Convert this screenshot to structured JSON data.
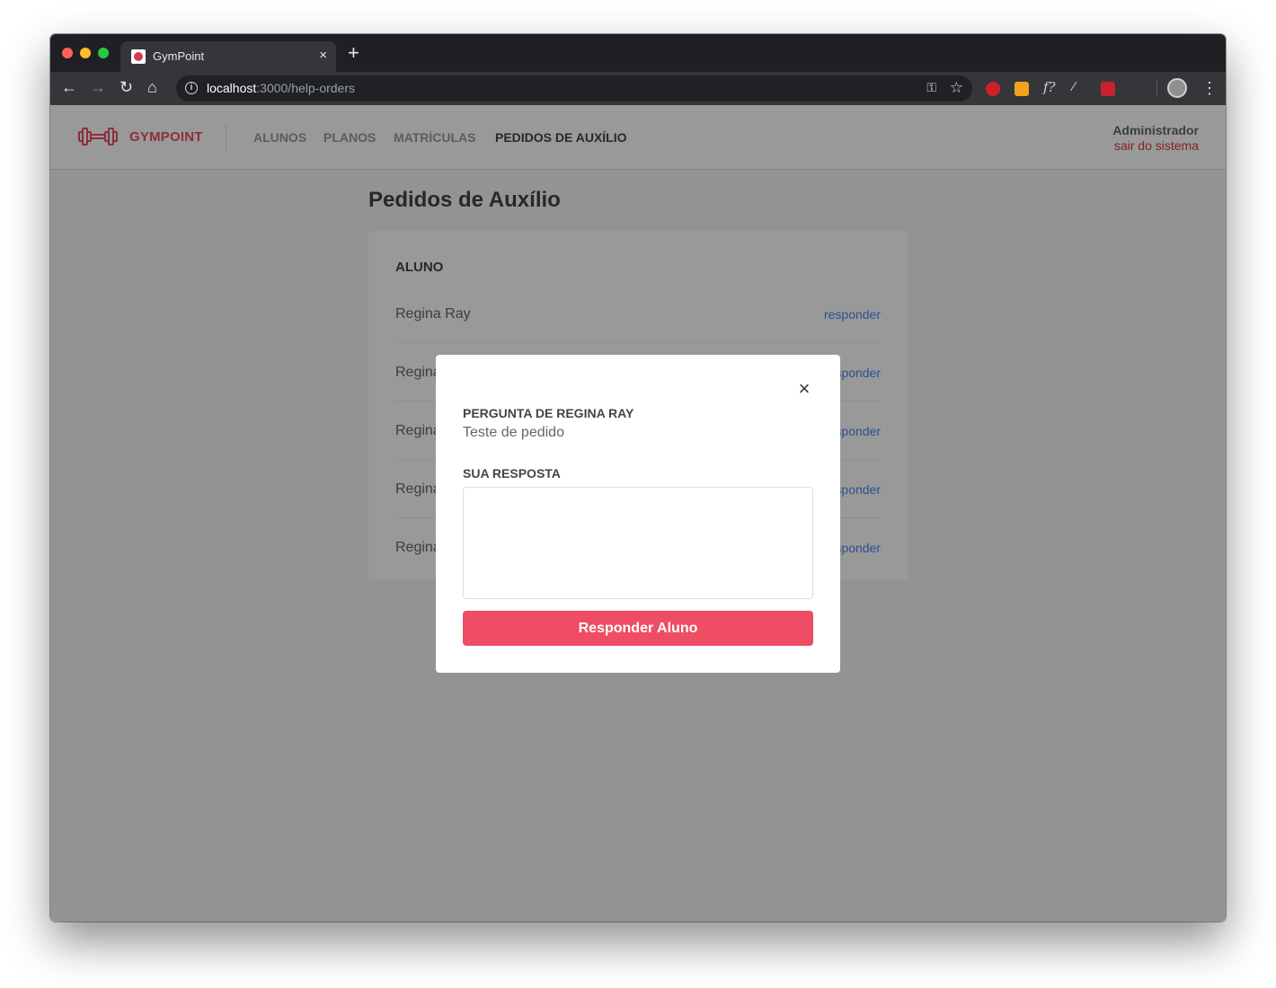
{
  "browser": {
    "tab_title": "GymPoint",
    "tab_close": "×",
    "new_tab": "+",
    "url_host": "localhost",
    "url_path": ":3000/help-orders"
  },
  "header": {
    "logo_text": "GYMPOINT",
    "nav": {
      "alunos": "ALUNOS",
      "planos": "PLANOS",
      "matriculas": "MATRÍCULAS",
      "pedidos": "PEDIDOS DE AUXÍLIO"
    },
    "user_name": "Administrador",
    "logout": "sair do sistema"
  },
  "main": {
    "title": "Pedidos de Auxílio",
    "column_header": "ALUNO",
    "rows": [
      {
        "name": "Regina Ray",
        "action": "responder"
      },
      {
        "name": "Regina Ray",
        "action": "responder"
      },
      {
        "name": "Regina Ray",
        "action": "responder"
      },
      {
        "name": "Regina Ray",
        "action": "responder"
      },
      {
        "name": "Regina Ray",
        "action": "responder"
      }
    ]
  },
  "modal": {
    "close": "×",
    "question_label": "PERGUNTA DE REGINA RAY",
    "question_text": "Teste de pedido",
    "answer_label": "SUA RESPOSTA",
    "answer_value": "",
    "submit_label": "Responder Aluno"
  },
  "colors": {
    "brand": "#ee4d64",
    "link": "#4d85ee",
    "logout": "#de3b3b"
  }
}
